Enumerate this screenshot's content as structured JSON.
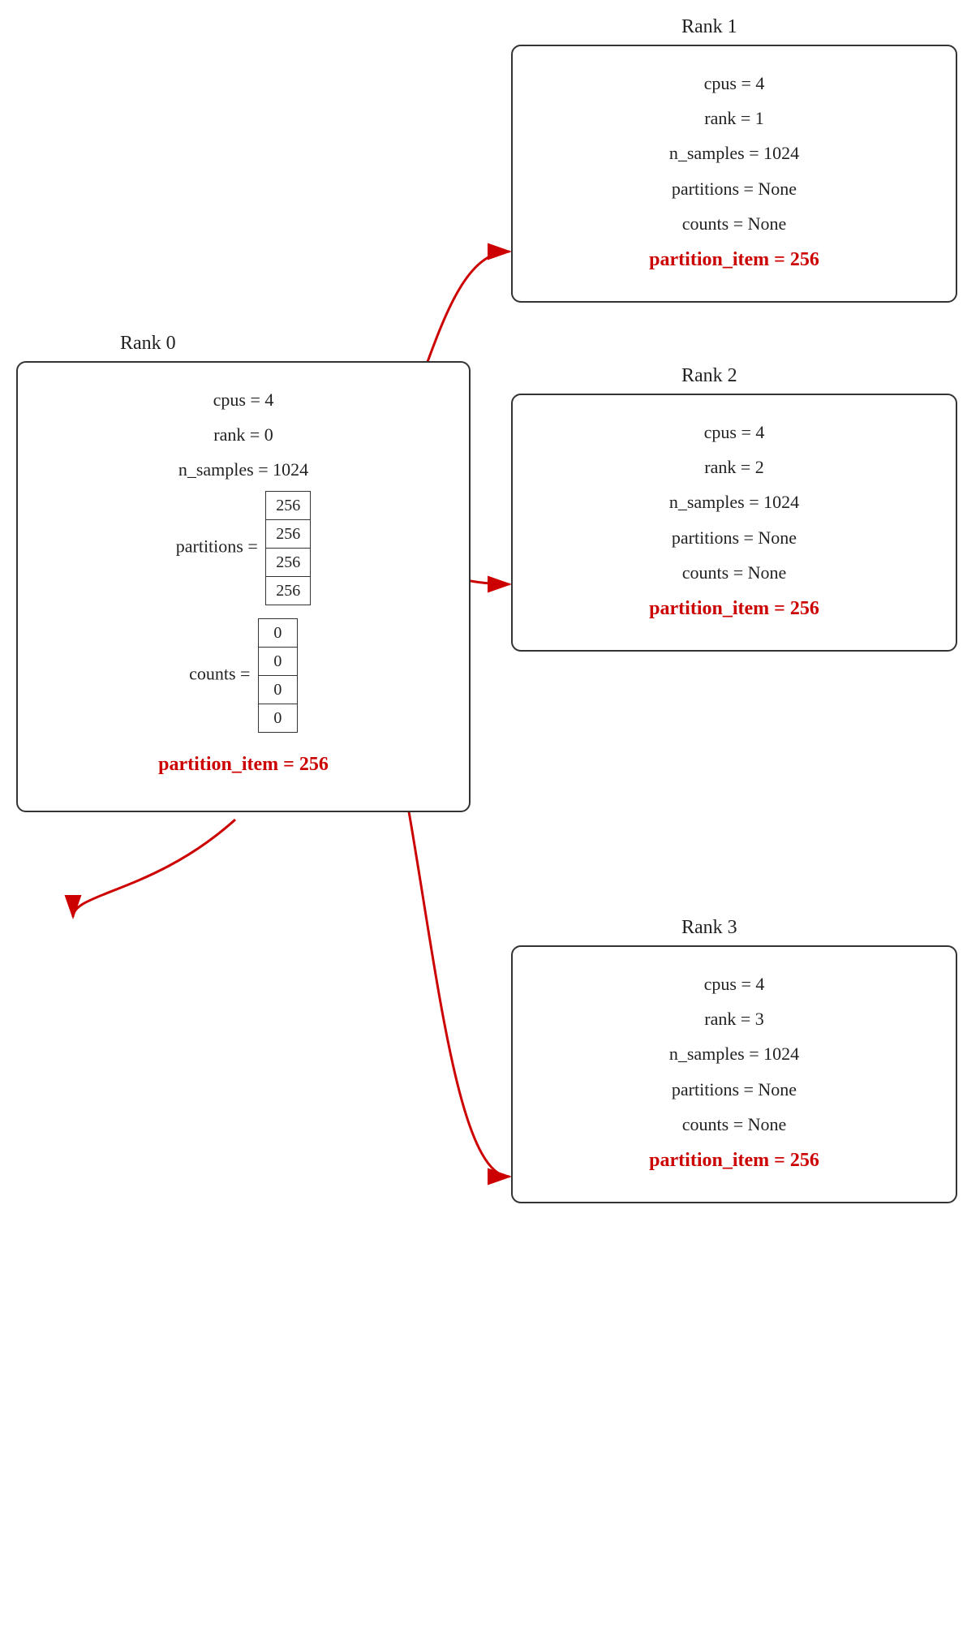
{
  "ranks": {
    "rank0": {
      "title": "Rank 0",
      "cpus": "cpus = 4",
      "rank": "rank = 0",
      "n_samples": "n_samples = 1024",
      "partitions_label": "partitions =",
      "partitions_values": [
        "256",
        "256",
        "256",
        "256"
      ],
      "counts_label": "counts =",
      "counts_values": [
        "0",
        "0",
        "0",
        "0"
      ],
      "partition_item_label": "partition_item = 256"
    },
    "rank1": {
      "title": "Rank 1",
      "cpus": "cpus = 4",
      "rank": "rank = 1",
      "n_samples": "n_samples = 1024",
      "partitions": "partitions = None",
      "counts": "counts = None",
      "partition_item_label": "partition_item = 256"
    },
    "rank2": {
      "title": "Rank 2",
      "cpus": "cpus = 4",
      "rank": "rank = 2",
      "n_samples": "n_samples = 1024",
      "partitions": "partitions = None",
      "counts": "counts = None",
      "partition_item_label": "partition_item = 256"
    },
    "rank3": {
      "title": "Rank 3",
      "cpus": "cpus = 4",
      "rank": "rank = 3",
      "n_samples": "n_samples = 1024",
      "partitions": "partitions = None",
      "counts": "counts = None",
      "partition_item_label": "partition_item = 256"
    }
  }
}
